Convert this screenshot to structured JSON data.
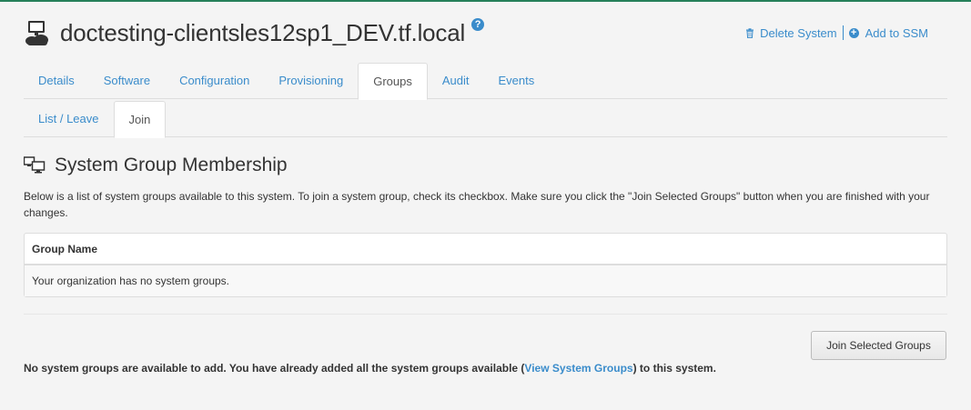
{
  "header": {
    "title": "doctesting-clientsles12sp1_DEV.tf.local",
    "help_icon": "?",
    "system_icon": "server-cloud-icon",
    "actions": {
      "delete_label": "Delete System",
      "add_ssm_label": "Add to SSM",
      "add_ssm_icon_glyph": "+"
    }
  },
  "tabs": [
    {
      "label": "Details"
    },
    {
      "label": "Software"
    },
    {
      "label": "Configuration"
    },
    {
      "label": "Provisioning"
    },
    {
      "label": "Groups",
      "active": true
    },
    {
      "label": "Audit"
    },
    {
      "label": "Events"
    }
  ],
  "subtabs": [
    {
      "label": "List / Leave"
    },
    {
      "label": "Join",
      "active": true
    }
  ],
  "section": {
    "title": "System Group Membership",
    "description": "Below is a list of system groups available to this system. To join a system group, check its checkbox. Make sure you click the \"Join Selected Groups\" button when you are finished with your changes."
  },
  "table": {
    "header": "Group Name",
    "empty_message": "Your organization has no system groups."
  },
  "join_button": "Join Selected Groups",
  "footer": {
    "before": "No system groups are available to add. You have already added all the system groups available (",
    "link": "View System Groups",
    "after": ") to this system."
  },
  "colors": {
    "accent": "#3a8ccb",
    "top_border": "#26805a",
    "background": "#f4f4f4"
  }
}
